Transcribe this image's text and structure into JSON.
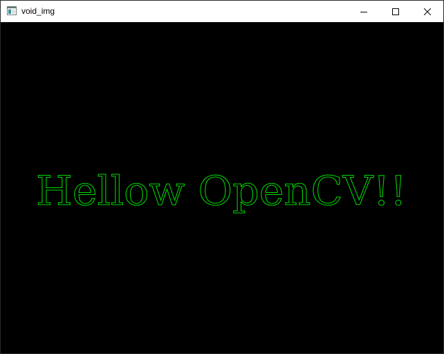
{
  "window": {
    "title": "void_img",
    "colors": {
      "titlebar_bg": "#ffffff",
      "canvas_bg": "#000000"
    }
  },
  "titlebar": {
    "icons": {
      "app": "app-window-icon",
      "minimize": "minimize-icon",
      "maximize": "maximize-icon",
      "close": "close-icon"
    }
  },
  "canvas": {
    "text": "Hellow OpenCV!!",
    "text_color": "#00dd00"
  }
}
